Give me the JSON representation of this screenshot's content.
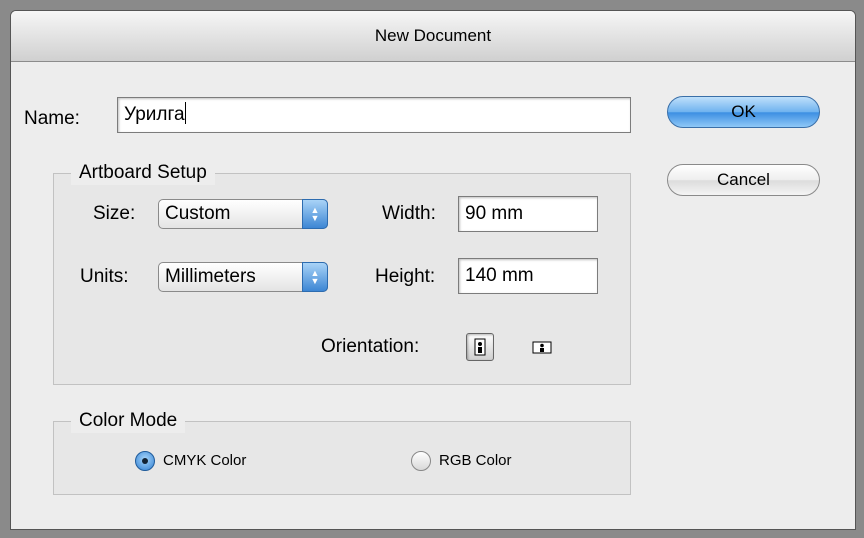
{
  "dialog": {
    "title": "New Document"
  },
  "name": {
    "label": "Name:",
    "value": "Урилга"
  },
  "artboard": {
    "legend": "Artboard Setup",
    "size_label": "Size:",
    "size_value": "Custom",
    "units_label": "Units:",
    "units_value": "Millimeters",
    "width_label": "Width:",
    "width_value": "90 mm",
    "height_label": "Height:",
    "height_value": "140 mm",
    "orientation_label": "Orientation:",
    "orientation_selected": "portrait"
  },
  "color_mode": {
    "legend": "Color Mode",
    "options": [
      {
        "label": "CMYK Color",
        "selected": true
      },
      {
        "label": "RGB Color",
        "selected": false
      }
    ]
  },
  "buttons": {
    "ok_label": "OK",
    "cancel_label": "Cancel"
  },
  "colors": {
    "accent": "#3c8fe2",
    "dialog_bg": "#ededed",
    "backdrop": "#8a8a8a"
  }
}
